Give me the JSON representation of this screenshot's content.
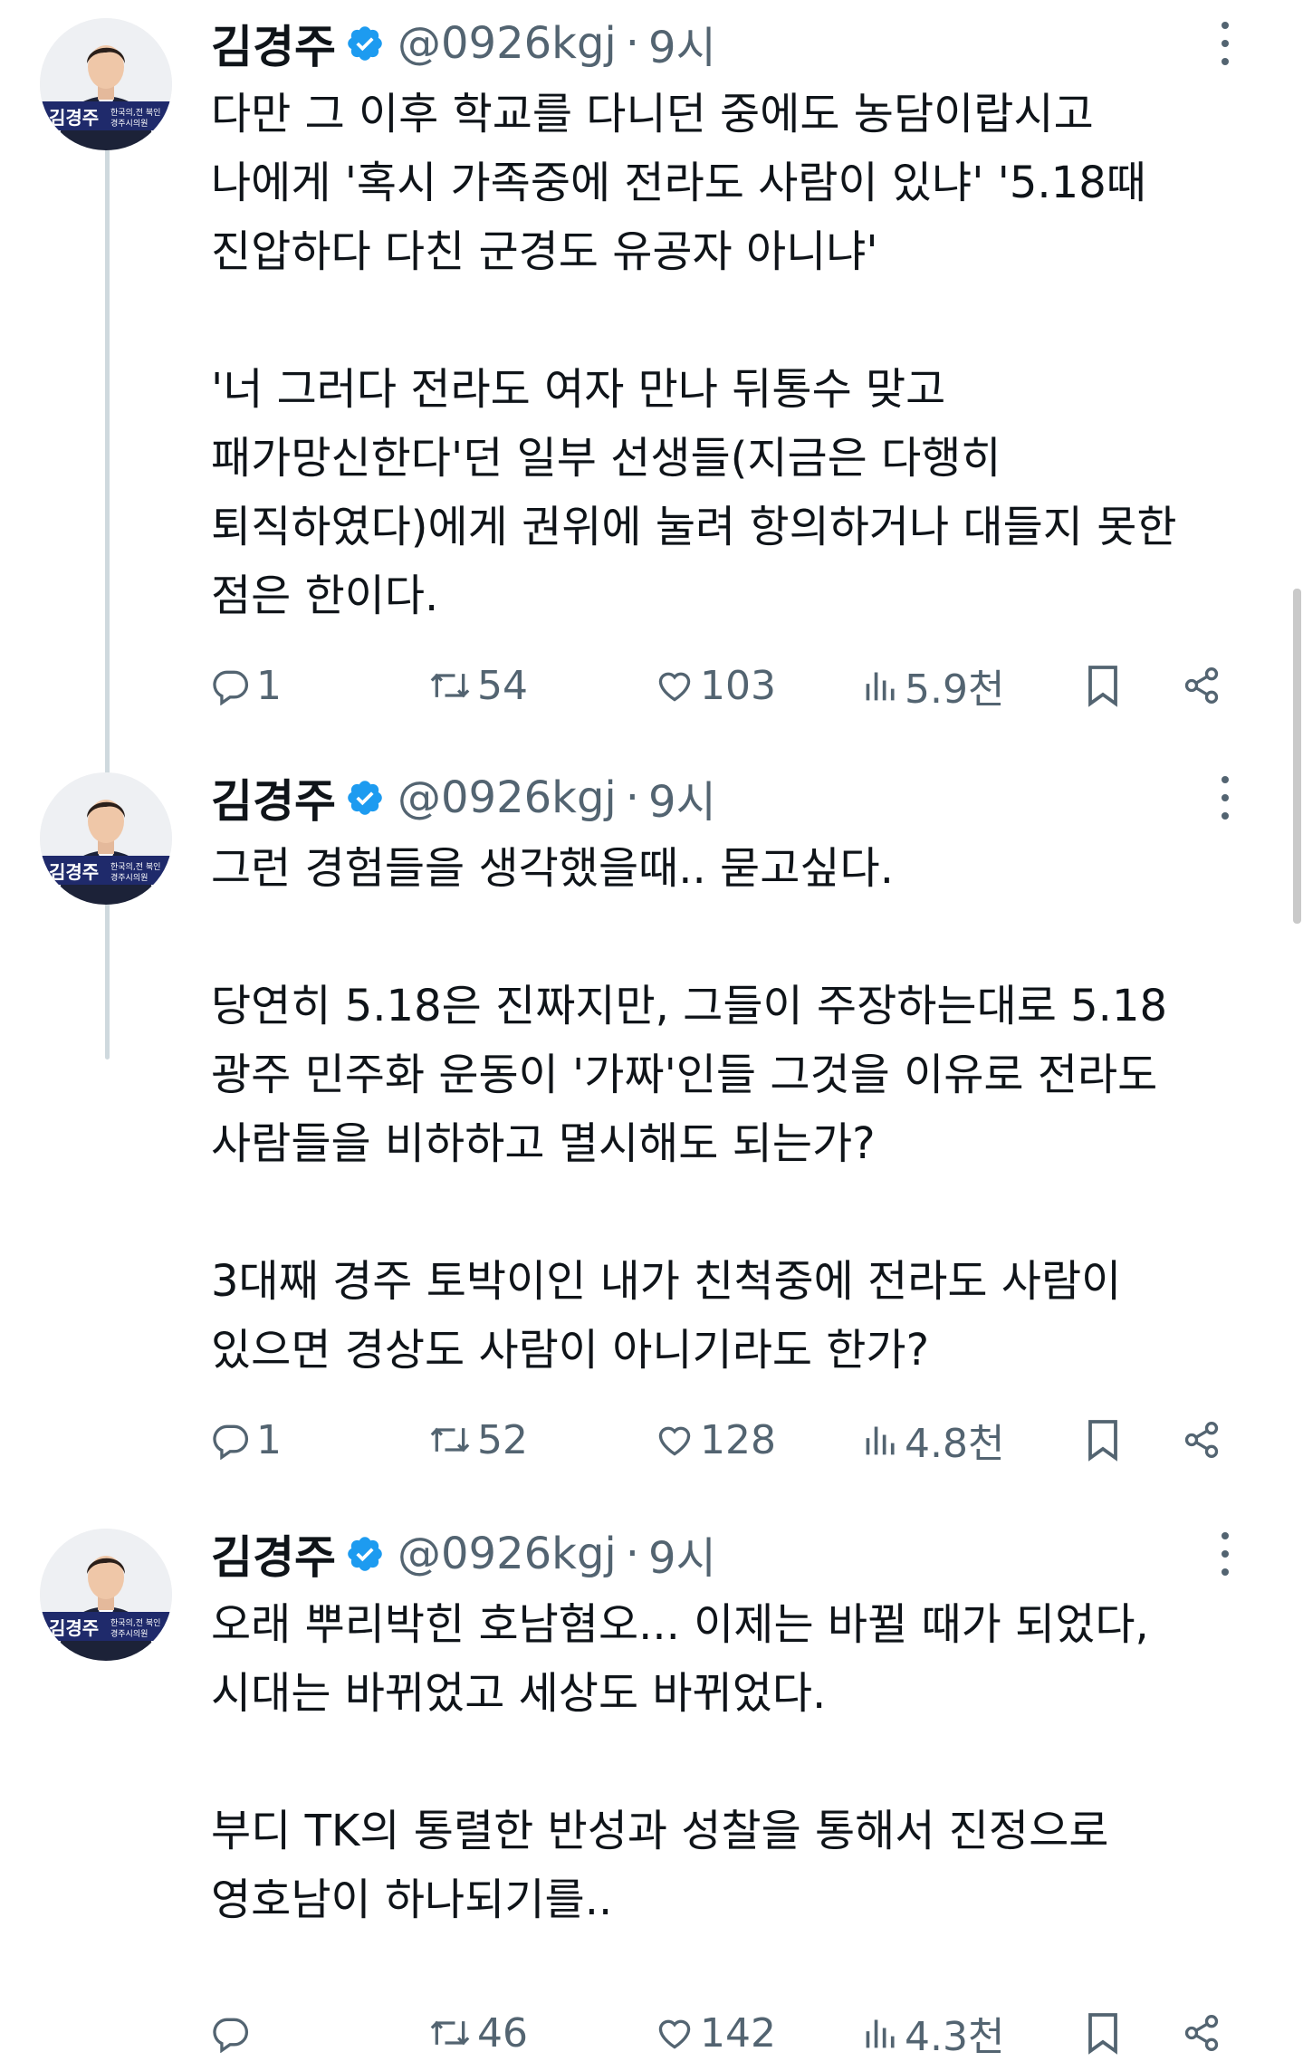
{
  "tweets": [
    {
      "author": {
        "name": "김경주",
        "handle": "@0926kgj",
        "time": "9시"
      },
      "avatar_badge": {
        "name": "김경주",
        "sub1": "한국의,전 북인",
        "sub2": "경주시의원"
      },
      "lines": [
        [
          "다만 그 이후 학교를 다니던 중에도 농담이랍시고",
          "나에게 '혹시 가족중에 전라도 사람이 있냐' '5.18때",
          "진압하다 다친 군경도 유공자 아니냐'"
        ],
        [
          "'너 그러다 전라도 여자 만나 뒤통수 맞고",
          "패가망신한다'던 일부 선생들(지금은 다행히",
          "퇴직하였다)에게 권위에 눌려 항의하거나 대들지 못한",
          "점은 한이다."
        ]
      ],
      "stats": {
        "replies": "1",
        "retweets": "54",
        "likes": "103",
        "views": "5.9천"
      }
    },
    {
      "author": {
        "name": "김경주",
        "handle": "@0926kgj",
        "time": "9시"
      },
      "avatar_badge": {
        "name": "김경주",
        "sub1": "한국의,전 북인",
        "sub2": "경주시의원"
      },
      "lines": [
        [
          "그런 경험들을 생각했을때.. 묻고싶다."
        ],
        [
          "당연히 5.18은 진짜지만, 그들이 주장하는대로 5.18",
          "광주 민주화 운동이 '가짜'인들 그것을 이유로 전라도",
          "사람들을 비하하고 멸시해도 되는가?"
        ],
        [
          "3대째 경주 토박이인 내가 친척중에 전라도 사람이",
          "있으면 경상도 사람이 아니기라도 한가?"
        ]
      ],
      "stats": {
        "replies": "1",
        "retweets": "52",
        "likes": "128",
        "views": "4.8천"
      }
    },
    {
      "author": {
        "name": "김경주",
        "handle": "@0926kgj",
        "time": "9시"
      },
      "avatar_badge": {
        "name": "김경주",
        "sub1": "한국의,전 북인",
        "sub2": "경주시의원"
      },
      "lines": [
        [
          "오래 뿌리박힌 호남혐오... 이제는 바뀔 때가 되었다,",
          "시대는 바뀌었고 세상도 바뀌었다."
        ],
        [
          "부디 TK의 통렬한 반성과 성찰을 통해서 진정으로",
          "영호남이 하나되기를.."
        ]
      ],
      "stats": {
        "replies": "",
        "retweets": "46",
        "likes": "142",
        "views": "4.3천"
      }
    }
  ],
  "colors": {
    "text": "#0f1419",
    "secondary": "#536471",
    "verified": "#1d9bf0",
    "thread_line": "#cfd9de",
    "badge": "#1f2a6b"
  },
  "icons": [
    "verified-badge-icon",
    "more-options-icon",
    "reply-icon",
    "retweet-icon",
    "like-icon",
    "views-icon",
    "bookmark-icon",
    "share-icon"
  ]
}
